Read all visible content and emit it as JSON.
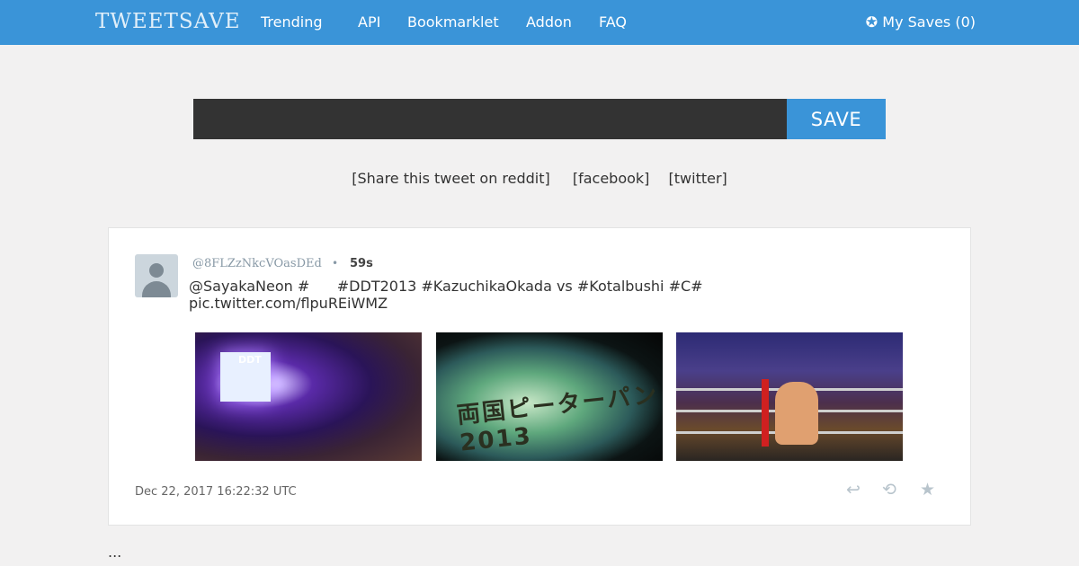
{
  "header": {
    "logo": "TWEETSAVE",
    "nav": [
      "Trending",
      "API",
      "Bookmarklet",
      "Addon",
      "FAQ"
    ],
    "my_saves": "✪ My Saves (0)",
    "bg_color": "#3a94d8"
  },
  "search": {
    "value": "",
    "placeholder": "",
    "save_label": "SAVE"
  },
  "share": {
    "reddit": "[Share this tweet on reddit]",
    "facebook": "[facebook]",
    "twitter": "[twitter]"
  },
  "tweet": {
    "handle": "@8FLZzNkcVOasDEd",
    "separator": "•",
    "age": "59s",
    "text": "@SayakaNeon #      #DDT2013 #KazuchikaOkada vs #Kotalbushi #C#\npic.twitter.com/flpuREiWMZ",
    "date": "Dec 22, 2017 16:22:32 UTC",
    "media": [
      {
        "icon": "arena-photo",
        "label": "DDT"
      },
      {
        "icon": "banner-photo",
        "label": "両国ピーターパン2013"
      },
      {
        "icon": "wrestling-photo"
      }
    ],
    "actions": {
      "reply_icon": "↩",
      "retweet_icon": "⟲",
      "favorite_icon": "★"
    }
  },
  "footer": {
    "ellipsis": "..."
  }
}
